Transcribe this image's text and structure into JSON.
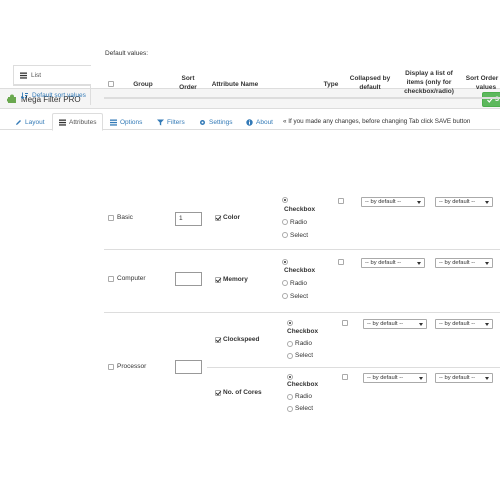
{
  "app": {
    "title": "Mega Filter PRO",
    "save_label": "S"
  },
  "tabs": [
    {
      "label": "Layout",
      "icon": "pencil-icon"
    },
    {
      "label": "Attributes",
      "icon": "list-icon",
      "active": true
    },
    {
      "label": "Options",
      "icon": "list-icon"
    },
    {
      "label": "Filters",
      "icon": "filter-icon"
    },
    {
      "label": "Settings",
      "icon": "gear-icon"
    },
    {
      "label": "About",
      "icon": "info-icon"
    }
  ],
  "tab_note": "« If you made any changes, before changing Tab click SAVE button",
  "sidebar": [
    {
      "label": "List",
      "icon": "list-icon",
      "active": true
    },
    {
      "label": "Default sort values",
      "icon": "sort-icon"
    }
  ],
  "default_values_label": "Default values:",
  "columns": {
    "group": "Group",
    "sort_order": [
      "Sort",
      "Order"
    ],
    "attribute_name": "Attribute Name",
    "type": "Type",
    "collapsed": [
      "Collapsed by",
      "default"
    ],
    "display_list": [
      "Display a list of",
      "items (only for",
      "checkbox/radio)"
    ],
    "sort_order_values": [
      "Sort Order of",
      "values"
    ]
  },
  "type_options": [
    "Checkbox",
    "Radio",
    "Select"
  ],
  "select_default": "-- by default --",
  "groups": [
    {
      "name": "Basic",
      "sort_order": "1",
      "attributes": [
        {
          "name": "Color",
          "checked": true,
          "type": "Checkbox"
        }
      ]
    },
    {
      "name": "Computer",
      "sort_order": "",
      "attributes": [
        {
          "name": "Memory",
          "checked": true,
          "type": "Checkbox"
        }
      ]
    },
    {
      "name": "Processor",
      "sort_order": "",
      "attributes": [
        {
          "name": "Clockspeed",
          "checked": true,
          "type": "Checkbox"
        },
        {
          "name": "No. of Cores",
          "checked": true,
          "type": "Checkbox"
        }
      ]
    }
  ],
  "colors": {
    "accent": "#337ab7",
    "save": "#5cb85c",
    "logo": "#6aa84f"
  }
}
